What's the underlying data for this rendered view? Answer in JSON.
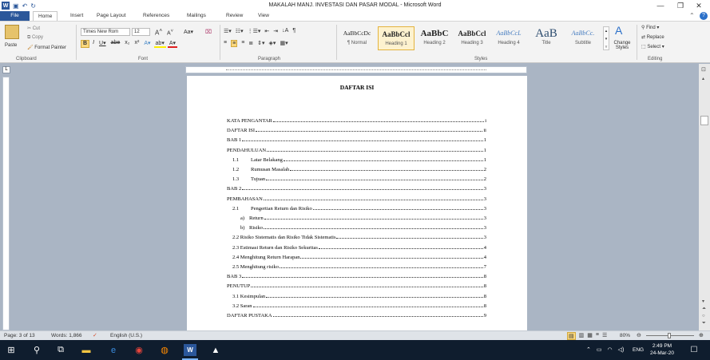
{
  "window": {
    "title": "MAKALAH MANJ. INVESTASI DAN PASAR MODAL  -  Microsoft Word",
    "minimize": "—",
    "restore": "❐",
    "close": "✕"
  },
  "tabs": [
    {
      "label": "File"
    },
    {
      "label": "Home"
    },
    {
      "label": "Insert"
    },
    {
      "label": "Page Layout"
    },
    {
      "label": "References"
    },
    {
      "label": "Mailings"
    },
    {
      "label": "Review"
    },
    {
      "label": "View"
    }
  ],
  "ribbon": {
    "clipboard": {
      "paste": "Paste",
      "cut": "Cut",
      "copy": "Copy",
      "format_painter": "Format Painter",
      "label": "Clipboard"
    },
    "font": {
      "font_name": "Times New Rom",
      "font_size": "12",
      "label": "Font"
    },
    "paragraph": {
      "label": "Paragraph"
    },
    "styles": {
      "label": "Styles",
      "items": [
        {
          "sample": "AaBbCcDc",
          "name": "¶ Normal"
        },
        {
          "sample": "AaBbCcl",
          "name": "Heading 1"
        },
        {
          "sample": "AaBbC",
          "name": "Heading 2"
        },
        {
          "sample": "AaBbCcl",
          "name": "Heading 3"
        },
        {
          "sample": "AaBbCcL",
          "name": "Heading 4"
        },
        {
          "sample": "AaB",
          "name": "Title"
        },
        {
          "sample": "AaBbCc.",
          "name": "Subtitle"
        }
      ],
      "change_styles": "Change Styles"
    },
    "editing": {
      "find": "Find",
      "replace": "Replace",
      "select": "Select",
      "label": "Editing"
    }
  },
  "document": {
    "heading": "DAFTAR ISI",
    "toc": [
      {
        "num": "",
        "text": "KATA PENGANTAR",
        "page": "i"
      },
      {
        "num": "",
        "text": "DAFTAR ISI",
        "page": "ii"
      },
      {
        "num": "",
        "text": "BAB 1",
        "page": "1"
      },
      {
        "num": "",
        "text": "PENDAHULUAN",
        "page": "1"
      },
      {
        "num": "1.1",
        "text": "Latar Belakang",
        "page": "1"
      },
      {
        "num": "1.2",
        "text": "Rumusan Masalah",
        "page": "2"
      },
      {
        "num": "1.3",
        "text": "Tujuan",
        "page": "2"
      },
      {
        "num": "",
        "text": "BAB 2",
        "page": "3"
      },
      {
        "num": "",
        "text": "PEMBAHASAN",
        "page": "3"
      },
      {
        "num": "2.1",
        "text": "Pengertian Return dan Risiko",
        "page": "3"
      },
      {
        "num": "a)",
        "text": "Return",
        "page": "3"
      },
      {
        "num": "b)",
        "text": "Risiko",
        "page": "3"
      },
      {
        "num": "",
        "text": "2.2 Risiko Sistematis dan Risiko Tidak Sistematis",
        "page": "3"
      },
      {
        "num": "",
        "text": "2.3 Estimasi Return dan Risiko Sekuritas",
        "page": "4"
      },
      {
        "num": "",
        "text": "2.4 Menghitung Return Harapan",
        "page": "4"
      },
      {
        "num": "",
        "text": "2.5 Menghitung risiko",
        "page": "7"
      },
      {
        "num": "",
        "text": "BAB 3",
        "page": "8"
      },
      {
        "num": "",
        "text": "PENUTUP",
        "page": "8"
      },
      {
        "num": "",
        "text": "3.1 Kesimpulan",
        "page": "8"
      },
      {
        "num": "",
        "text": "3.2 Saran",
        "page": "8"
      },
      {
        "num": "",
        "text": "DAFTAR PUSTAKA",
        "page": "9"
      }
    ]
  },
  "status": {
    "page": "Page: 3 of 13",
    "words": "Words: 1,866",
    "language": "English (U.S.)",
    "zoom": "80%"
  },
  "taskbar": {
    "language": "ENG",
    "time": "2:49 PM",
    "date": "24-Mar-20"
  }
}
